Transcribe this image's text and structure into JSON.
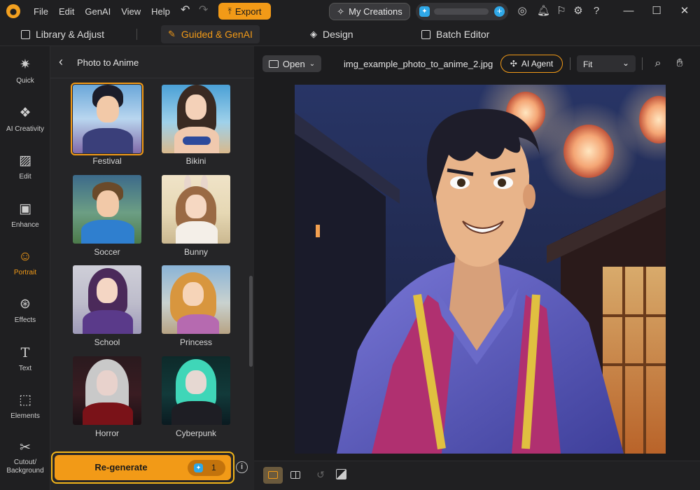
{
  "titlebar": {
    "menu": [
      "File",
      "Edit",
      "GenAI",
      "View",
      "Help"
    ],
    "export_label": "Export",
    "my_creations_label": "My Creations"
  },
  "modes": {
    "library": "Library & Adjust",
    "guided": "Guided & GenAI",
    "design": "Design",
    "batch": "Batch Editor"
  },
  "rail": [
    {
      "label": "Quick",
      "icon": "magic-wand-icon"
    },
    {
      "label": "AI Creativity",
      "icon": "ai-creativity-icon"
    },
    {
      "label": "Edit",
      "icon": "edit-image-icon"
    },
    {
      "label": "Enhance",
      "icon": "enhance-icon"
    },
    {
      "label": "Portrait",
      "icon": "portrait-icon",
      "active": true
    },
    {
      "label": "Effects",
      "icon": "effects-icon"
    },
    {
      "label": "Text",
      "icon": "text-icon"
    },
    {
      "label": "Elements",
      "icon": "elements-icon"
    },
    {
      "label": "Cutout/ Background",
      "icon": "cutout-icon"
    }
  ],
  "panel": {
    "title": "Photo to Anime",
    "styles": [
      {
        "label": "Festival",
        "selected": true
      },
      {
        "label": "Bikini"
      },
      {
        "label": "Soccer"
      },
      {
        "label": "Bunny"
      },
      {
        "label": "School"
      },
      {
        "label": "Princess"
      },
      {
        "label": "Horror"
      },
      {
        "label": "Cyberpunk"
      }
    ],
    "regenerate_label": "Re-generate",
    "regenerate_cost": "1"
  },
  "canvas": {
    "open_label": "Open",
    "file_name": "img_example_photo_to_anime_2.jpg",
    "agent_label": "AI Agent",
    "zoom_mode": "Fit"
  },
  "colors": {
    "accent": "#f29a17",
    "credit_blue": "#2fa8e8",
    "bg": "#1b1b1d"
  }
}
